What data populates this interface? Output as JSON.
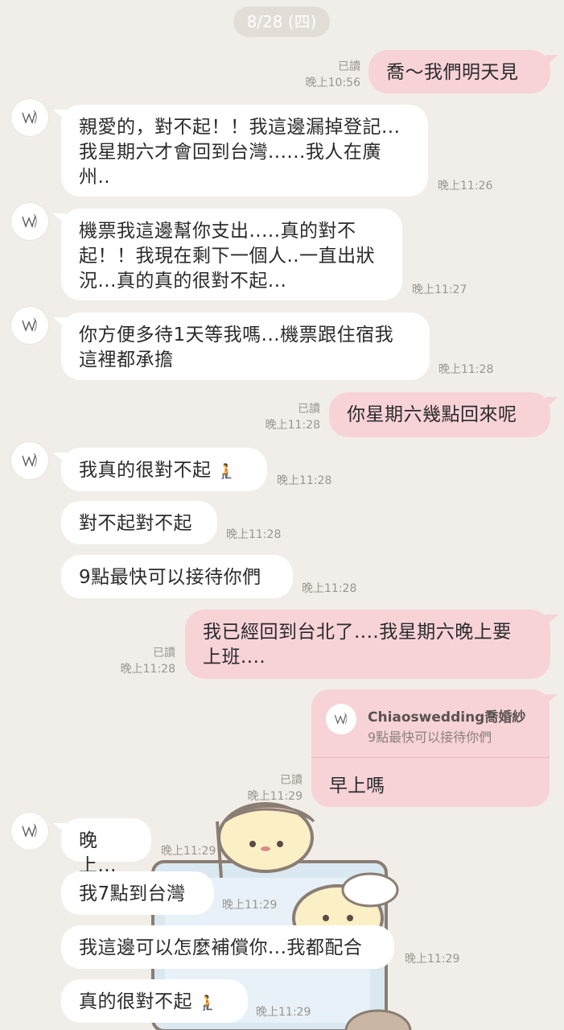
{
  "date_label": "8/28 (四)",
  "messages": [
    {
      "dir": "out",
      "text": "喬～我們明天見",
      "read": "已讀",
      "time": "晚上10:56"
    },
    {
      "dir": "in",
      "text": "親愛的，對不起！！我這邊漏掉登記...\n我星期六才會回到台灣......我人在廣\n州..",
      "time": "晚上11:26"
    },
    {
      "dir": "in",
      "text": "機票我這邊幫你支出.....真的對不\n起！！我現在剩下一個人..一直出狀\n況...真的真的很對不起...",
      "time": "晚上11:27"
    },
    {
      "dir": "in",
      "text": "你方便多待1天等我嗎...機票跟住宿我\n這裡都承擔",
      "time": "晚上11:28"
    },
    {
      "dir": "out",
      "text": "你星期六幾點回來呢",
      "read": "已讀",
      "time": "晚上11:28"
    },
    {
      "dir": "in",
      "text": "我真的很對不起",
      "emoji": "🧎",
      "time": "晚上11:28"
    },
    {
      "dir": "in",
      "text": "對不起對不起",
      "time": "晚上11:28"
    },
    {
      "dir": "in",
      "text": "9點最快可以接待你們",
      "time": "晚上11:28"
    },
    {
      "dir": "out",
      "text": "我已經回到台北了....我星期六晚上要\n上班....",
      "read": "已讀",
      "time": "晚上11:28"
    },
    {
      "dir": "out",
      "quote_name": "Chiaoswedding喬婚紗",
      "quote_text": "9點最快可以接待你們",
      "text": "早上嗎",
      "read": "已讀",
      "time": "晚上11:29"
    },
    {
      "dir": "in",
      "text": "晚上...",
      "time": "晚上11:29"
    },
    {
      "dir": "in",
      "text": "我7點到台灣",
      "time": "晚上11:29"
    },
    {
      "dir": "in",
      "text": "我這邊可以怎麼補償你...我都配合",
      "time": "晚上11:29"
    },
    {
      "dir": "in",
      "text": "真的很對不起",
      "emoji": "🧎",
      "time": "晚上11:29"
    }
  ]
}
